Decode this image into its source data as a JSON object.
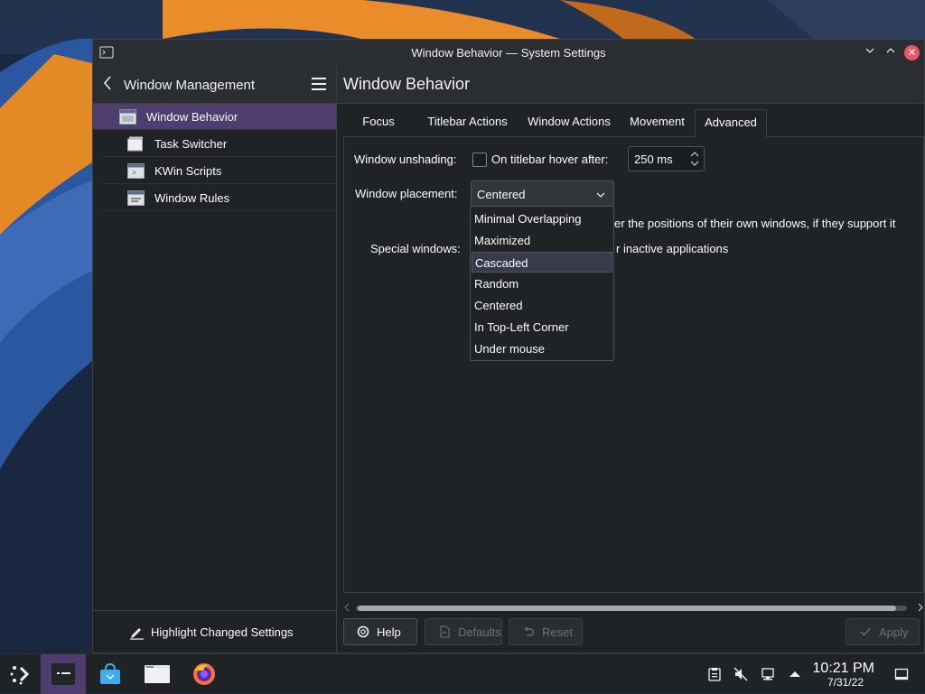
{
  "window": {
    "title": "Window Behavior — System Settings"
  },
  "sidebar": {
    "heading": "Window Management",
    "items": [
      {
        "label": "Window Behavior",
        "active": true
      },
      {
        "label": "Task Switcher",
        "active": false
      },
      {
        "label": "KWin Scripts",
        "active": false
      },
      {
        "label": "Window Rules",
        "active": false
      }
    ],
    "footer_label": "Highlight Changed Settings"
  },
  "content": {
    "page_title": "Window Behavior",
    "tabs": [
      {
        "label": "Focus",
        "active": false
      },
      {
        "label": "Titlebar Actions",
        "active": false
      },
      {
        "label": "Window Actions",
        "active": false
      },
      {
        "label": "Movement",
        "active": false
      },
      {
        "label": "Advanced",
        "active": true
      }
    ],
    "unshading": {
      "label": "Window unshading:",
      "checkbox_label": "On titlebar hover after:",
      "checked": false,
      "value": "250 ms"
    },
    "placement": {
      "label": "Window placement:",
      "value": "Centered",
      "options": [
        "Minimal Overlapping",
        "Maximized",
        "Cascaded",
        "Random",
        "Centered",
        "In Top-Left Corner",
        "Under mouse"
      ],
      "hovered": "Cascaded"
    },
    "partial_text_1": "er the positions of their own windows, if they support it",
    "special_label": "Special windows:",
    "partial_text_2": "r inactive applications"
  },
  "buttons": {
    "help": "Help",
    "defaults": "Defaults",
    "reset": "Reset",
    "apply": "Apply"
  },
  "taskbar": {
    "time": "10:21 PM",
    "date": "7/31/22"
  },
  "colors": {
    "accent": "#4e3d6e",
    "close": "#ed5565",
    "background": "#202326"
  }
}
